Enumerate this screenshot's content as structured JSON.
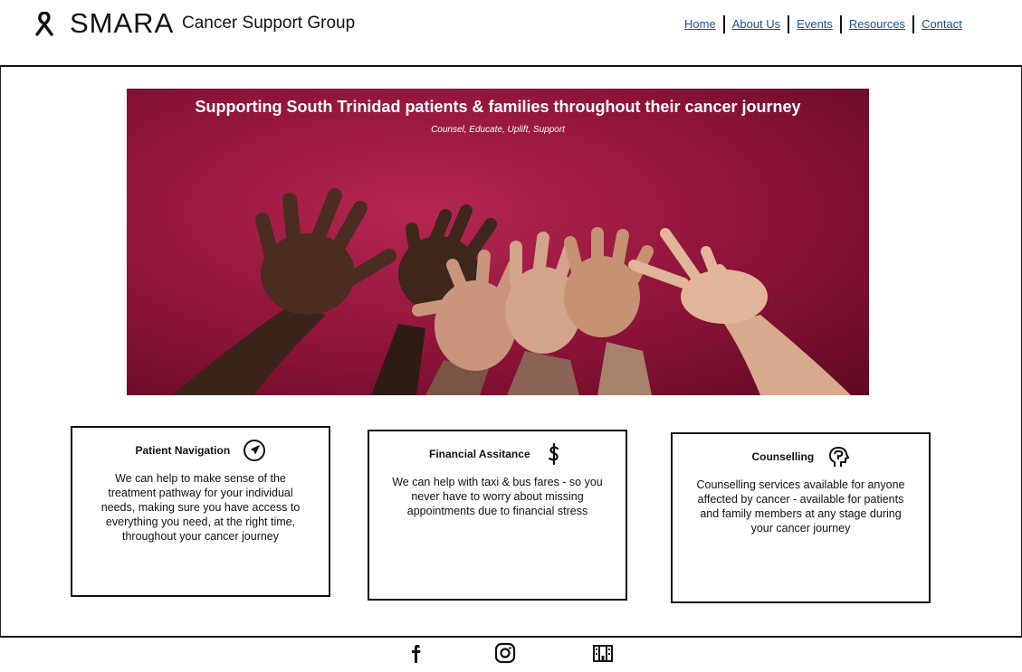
{
  "header": {
    "brand": "SMARA",
    "subtitle": "Cancer Support Group",
    "logo_icon": "ribbon-icon"
  },
  "nav": {
    "items": [
      {
        "label": "Home"
      },
      {
        "label": "About Us"
      },
      {
        "label": "Events"
      },
      {
        "label": "Resources"
      },
      {
        "label": "Contact"
      }
    ],
    "link_color": "#1f4f8f"
  },
  "hero": {
    "title": "Supporting South Trinidad patients & families throughout their cancer journey",
    "subtitle": "Counsel, Educate, Uplift, Support",
    "background_color": "#9b1a43"
  },
  "cards": [
    {
      "title": "Patient Navigation",
      "icon": "compass-icon",
      "body": "We can help to make sense of the treatment pathway for your individual needs, making sure you have access to everything you need, at the right time, throughout your cancer journey"
    },
    {
      "title": "Financial Assitance",
      "icon": "dollar-icon",
      "body": "We can help with taxi & bus fares - so you never have to worry about missing appointments due to financial stress"
    },
    {
      "title": "Counselling",
      "icon": "head-brain-icon",
      "body": "Counselling services available for anyone affected by cancer - available for patients and family members at any stage during your cancer journey"
    }
  ],
  "footer": {
    "social_icons": [
      "facebook-icon",
      "instagram-icon",
      "building-icon"
    ]
  }
}
